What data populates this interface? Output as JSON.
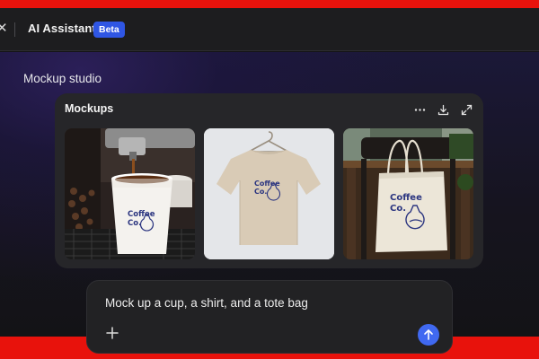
{
  "app": {
    "title": "AI Assistant",
    "badge": "Beta"
  },
  "workspace": {
    "section_label": "Mockup studio"
  },
  "card": {
    "title": "Mockups",
    "actions": [
      {
        "name": "more-options-icon"
      },
      {
        "name": "download-icon"
      },
      {
        "name": "expand-icon"
      }
    ],
    "mockups": [
      {
        "name": "cup-mockup",
        "logo_line1": "Coffee",
        "logo_line2": "Co."
      },
      {
        "name": "shirt-mockup",
        "logo_line1": "Coffee",
        "logo_line2": "Co."
      },
      {
        "name": "tote-bag-mockup",
        "logo_line1": "Coffee",
        "logo_line2": "Co."
      }
    ]
  },
  "prompt": {
    "text": "Mock up a cup, a shirt, and a tote bag",
    "add_icon": "plus-icon",
    "send_icon": "arrow-up-icon"
  },
  "colors": {
    "accent_red": "#e8120c",
    "badge_blue": "#2f56e4",
    "send_blue": "#4069f1",
    "logo_navy": "#2b3580"
  }
}
